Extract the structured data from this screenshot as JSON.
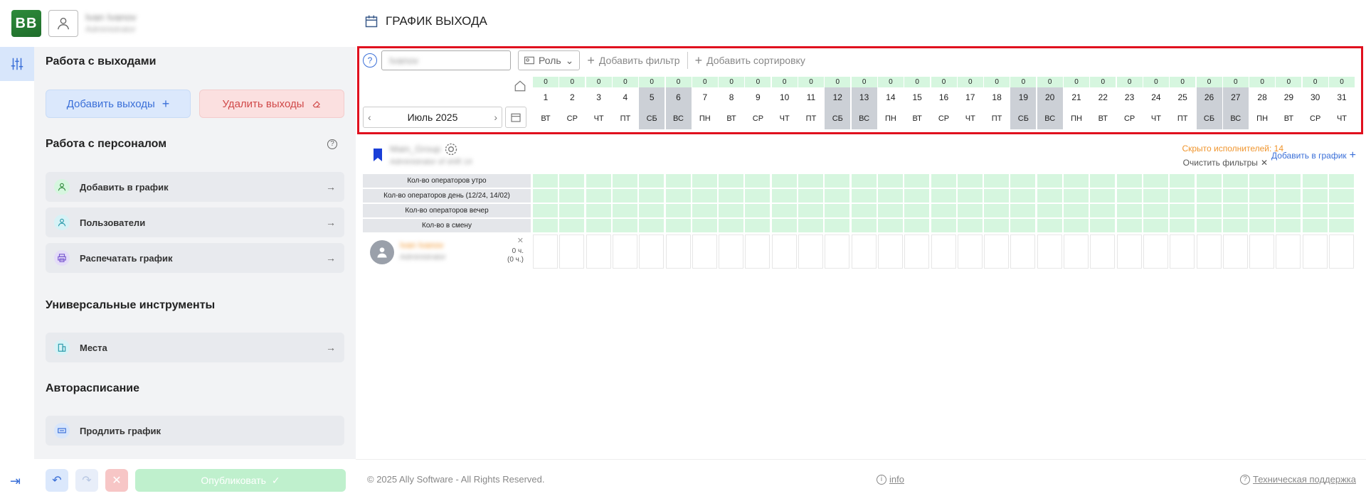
{
  "logo": {
    "text": "BB"
  },
  "user": {
    "name": "Ivan Ivanov",
    "role": "Administrator"
  },
  "page": {
    "title": "ГРАФИК ВЫХОДА"
  },
  "sidebar": {
    "shifts_section": {
      "title": "Работа с выходами",
      "add_label": "Добавить выходы",
      "delete_label": "Удалить выходы"
    },
    "staff_section": {
      "title": "Работа с персоналом",
      "items": [
        {
          "label": "Добавить в график",
          "icon": "user-icon"
        },
        {
          "label": "Пользователи",
          "icon": "user-icon"
        },
        {
          "label": "Распечатать график",
          "icon": "printer-icon"
        }
      ]
    },
    "tools_section": {
      "title": "Универсальные инструменты",
      "items": [
        {
          "label": "Места",
          "icon": "building-icon"
        }
      ]
    },
    "auto_section": {
      "title": "Авторасписание",
      "items": [
        {
          "label": "Продлить график",
          "icon": "extend-icon"
        }
      ]
    },
    "bottom": {
      "publish_label": "Опубликовать"
    }
  },
  "toolbar": {
    "search_value": "Ivanov",
    "role_label": "Роль",
    "add_filter_label": "Добавить фильтр",
    "add_sort_label": "Добавить сортировку"
  },
  "calendar": {
    "month_label": "Июль 2025",
    "days": [
      {
        "n": "1",
        "wd": "ВТ",
        "c": "0",
        "we": false
      },
      {
        "n": "2",
        "wd": "СР",
        "c": "0",
        "we": false
      },
      {
        "n": "3",
        "wd": "ЧТ",
        "c": "0",
        "we": false
      },
      {
        "n": "4",
        "wd": "ПТ",
        "c": "0",
        "we": false
      },
      {
        "n": "5",
        "wd": "СБ",
        "c": "0",
        "we": true
      },
      {
        "n": "6",
        "wd": "ВС",
        "c": "0",
        "we": true
      },
      {
        "n": "7",
        "wd": "ПН",
        "c": "0",
        "we": false
      },
      {
        "n": "8",
        "wd": "ВТ",
        "c": "0",
        "we": false
      },
      {
        "n": "9",
        "wd": "СР",
        "c": "0",
        "we": false
      },
      {
        "n": "10",
        "wd": "ЧТ",
        "c": "0",
        "we": false
      },
      {
        "n": "11",
        "wd": "ПТ",
        "c": "0",
        "we": false
      },
      {
        "n": "12",
        "wd": "СБ",
        "c": "0",
        "we": true
      },
      {
        "n": "13",
        "wd": "ВС",
        "c": "0",
        "we": true
      },
      {
        "n": "14",
        "wd": "ПН",
        "c": "0",
        "we": false
      },
      {
        "n": "15",
        "wd": "ВТ",
        "c": "0",
        "we": false
      },
      {
        "n": "16",
        "wd": "СР",
        "c": "0",
        "we": false
      },
      {
        "n": "17",
        "wd": "ЧТ",
        "c": "0",
        "we": false
      },
      {
        "n": "18",
        "wd": "ПТ",
        "c": "0",
        "we": false
      },
      {
        "n": "19",
        "wd": "СБ",
        "c": "0",
        "we": true
      },
      {
        "n": "20",
        "wd": "ВС",
        "c": "0",
        "we": true
      },
      {
        "n": "21",
        "wd": "ПН",
        "c": "0",
        "we": false
      },
      {
        "n": "22",
        "wd": "ВТ",
        "c": "0",
        "we": false
      },
      {
        "n": "23",
        "wd": "СР",
        "c": "0",
        "we": false
      },
      {
        "n": "24",
        "wd": "ЧТ",
        "c": "0",
        "we": false
      },
      {
        "n": "25",
        "wd": "ПТ",
        "c": "0",
        "we": false
      },
      {
        "n": "26",
        "wd": "СБ",
        "c": "0",
        "we": true
      },
      {
        "n": "27",
        "wd": "ВС",
        "c": "0",
        "we": true
      },
      {
        "n": "28",
        "wd": "ПН",
        "c": "0",
        "we": false
      },
      {
        "n": "29",
        "wd": "ВТ",
        "c": "0",
        "we": false
      },
      {
        "n": "30",
        "wd": "СР",
        "c": "0",
        "we": false
      },
      {
        "n": "31",
        "wd": "ЧТ",
        "c": "0",
        "we": false
      }
    ]
  },
  "employee": {
    "group_name": "Main_Group",
    "group_sub": "Administrator of shift 14",
    "hidden_label": "Скрыто исполнителей: 14",
    "clear_filters_label": "Очистить фильтры",
    "add_to_schedule_label": "Добавить в график"
  },
  "stats": {
    "rows": [
      "Кол-во операторов утро",
      "Кол-во операторов день (12/24, 14/02)",
      "Кол-во операторов вечер",
      "Кол-во в смену"
    ]
  },
  "person": {
    "name": "Ivan Ivanov",
    "sub": "Administrator",
    "hours1": "0 ч.",
    "hours2": "(0 ч.)"
  },
  "footer": {
    "copyright": "© 2025 Ally Software - All Rights Reserved.",
    "info_label": "info",
    "support_label": "Техническая поддержка"
  },
  "colors": {
    "accent": "#3a6fd8",
    "highlight": "#e0101e",
    "weekend": "#ccd0d6",
    "green_cell": "#d6f6df"
  }
}
